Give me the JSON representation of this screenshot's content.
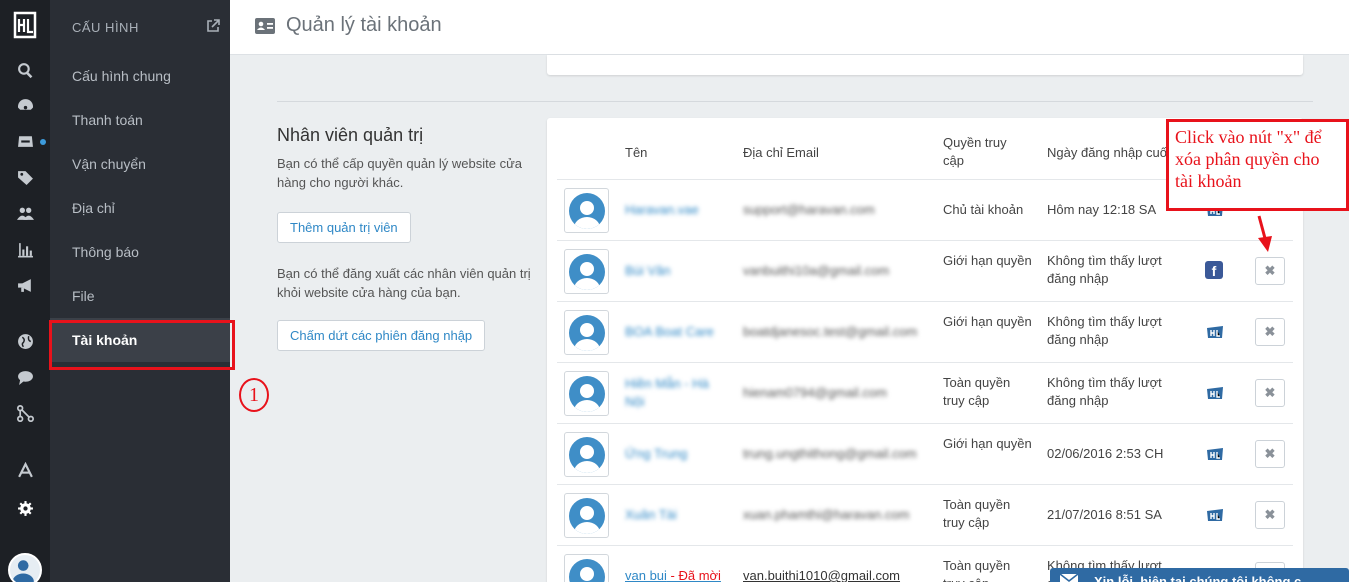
{
  "header": {
    "title": "Quản lý tài khoản",
    "icon": "id-card-icon"
  },
  "rail": {
    "icons": [
      "search-icon",
      "dashboard-icon",
      "inbox-icon",
      "tag-icon",
      "users-icon",
      "bar-chart-icon",
      "megaphone-icon",
      "globe-icon",
      "chat-icon",
      "share-icon",
      "apps-icon",
      "gear-icon"
    ]
  },
  "sidebar": {
    "heading": "CẤU HÌNH",
    "items": [
      {
        "label": "Cấu hình chung"
      },
      {
        "label": "Thanh toán"
      },
      {
        "label": "Vận chuyển"
      },
      {
        "label": "Địa chỉ"
      },
      {
        "label": "Thông báo"
      },
      {
        "label": "File"
      },
      {
        "label": "Tài khoản"
      }
    ]
  },
  "step_number": "1",
  "staff": {
    "heading": "Nhân viên quản trị",
    "desc1": "Bạn có thể cấp quyền quản lý website cửa hàng cho người khác.",
    "add_button": "Thêm quản trị viên",
    "desc2": "Bạn có thể đăng xuất các nhân viên quản trị khỏi website cửa hàng của bạn.",
    "logout_button": "Chấm dứt các phiên đăng nhập"
  },
  "table": {
    "columns": [
      "Tên",
      "Địa chỉ Email",
      "Quyền truy cập",
      "Ngày đăng nhập cuối"
    ],
    "rows": [
      {
        "name": "Haravan.vae",
        "email": "support@haravan.com",
        "permission": "Chủ tài khoản",
        "last_login": "Hôm nay 12:18 SA",
        "source": "haravan-icon",
        "deletable": false
      },
      {
        "name": "Bùi Vân",
        "email": "vanbuithi10a@gmail.com",
        "permission": "Giới hạn quyền",
        "last_login": "Không tìm thấy lượt đăng nhập",
        "source": "facebook-icon",
        "deletable": true
      },
      {
        "name": "BOA Boat Care",
        "email": "boatdjanesoc.test@gmail.com",
        "permission": "Giới hạn quyền",
        "last_login": "Không tìm thấy lượt đăng nhập",
        "source": "haravan-icon",
        "deletable": true
      },
      {
        "name": "Hiền Mẫn - Hà Nội",
        "email": "hienam0794@gmail.com",
        "permission": "Toàn quyền truy cập",
        "last_login": "Không tìm thấy lượt đăng nhập",
        "source": "haravan-icon",
        "deletable": true
      },
      {
        "name": "Ứng Trung",
        "email": "trung.ungthithong@gmail.com",
        "permission": "Giới hạn quyền",
        "last_login": "02/06/2016 2:53 CH",
        "source": "haravan-icon",
        "deletable": true
      },
      {
        "name": "Xuân Tài",
        "email": "xuan.phamthi@haravan.com",
        "permission": "Toàn quyền truy cập",
        "last_login": "21/07/2016 8:51 SA",
        "source": "haravan-icon",
        "deletable": true
      },
      {
        "name": "van bui",
        "pending": " - Đã mời",
        "email": "van.buithi1010@gmail.com",
        "permission": "Toàn quyền truy cập",
        "last_login": "Không tìm thấy lượt đăng nhập",
        "source": "haravan-icon",
        "deletable": true
      }
    ]
  },
  "annotation": {
    "text": "Click vào nút \"x\" để xóa phân quyền cho tài khoản"
  },
  "chat": {
    "label": "Xin lỗi, hiện tại chúng tôi không c"
  },
  "colors": {
    "accent": "#2f88c6",
    "highlight": "#e8121b",
    "rail": "#1d2025",
    "sidebar": "#2a2e35"
  }
}
